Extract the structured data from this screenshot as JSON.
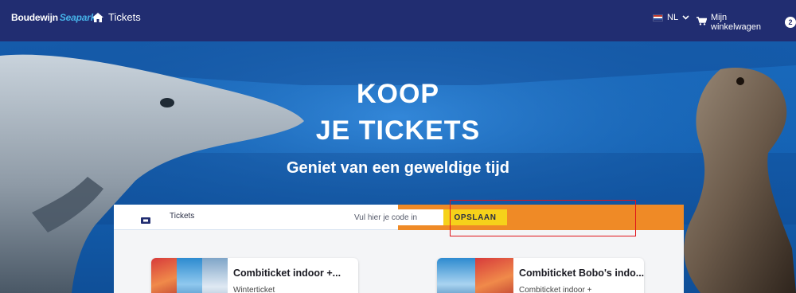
{
  "nav": {
    "logo_part1": "Boudewijn",
    "logo_part2": "Seapark",
    "home_icon": "home-icon",
    "home_label": "Tickets",
    "language": "NL",
    "cart_label": "Mijn winkelwagen",
    "cart_count": "2"
  },
  "hero": {
    "title_line1": "KOOP",
    "title_line2": "JE TICKETS",
    "subtitle": "Geniet van een geweldige tijd"
  },
  "panel": {
    "tab_label": "Tickets",
    "code_placeholder": "Vul hier je code in",
    "save_label": "OPSLAAN"
  },
  "cards": [
    {
      "title": "Combiticket indoor +...",
      "subtitle": "Winterticket"
    },
    {
      "title": "Combiticket Bobo's indo...",
      "subtitle": "Combiticket indoor +"
    }
  ],
  "colors": {
    "nav_bg": "#212d71",
    "accent_orange": "#ef8a26",
    "button_yellow": "#f6d21a",
    "highlight_red": "#e0151b"
  }
}
